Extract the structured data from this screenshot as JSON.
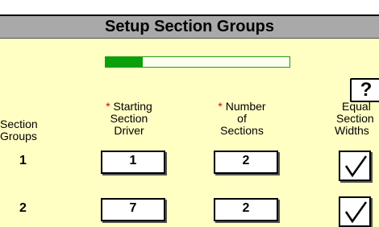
{
  "header": {
    "title": "Setup Section Groups"
  },
  "progress": {
    "value": 0.2
  },
  "help": {
    "label": "?"
  },
  "columns": {
    "section_groups": [
      "Section",
      "Groups"
    ],
    "starting_driver": {
      "required": "*",
      "line1": "Starting",
      "line2": "Section",
      "line3": "Driver"
    },
    "num_sections": {
      "required": "*",
      "line1": "Number",
      "line2": "of",
      "line3": "Sections"
    },
    "equal_widths": [
      "Equal",
      "Section",
      "Widths"
    ]
  },
  "rows": [
    {
      "group": "1",
      "starting_driver": "1",
      "num_sections": "2",
      "equal_widths": true
    },
    {
      "group": "2",
      "starting_driver": "7",
      "num_sections": "2",
      "equal_widths": true
    }
  ]
}
